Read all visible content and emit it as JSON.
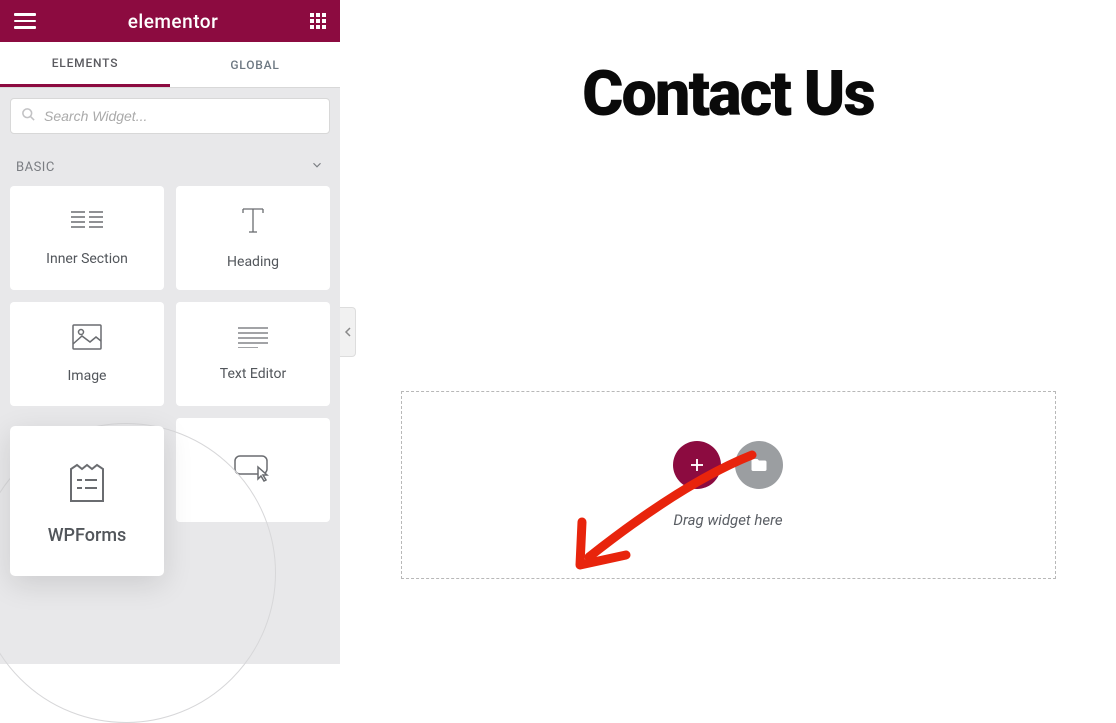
{
  "header": {
    "brand": "elementor"
  },
  "tabs": {
    "elements": "ELEMENTS",
    "global": "GLOBAL"
  },
  "search": {
    "placeholder": "Search Widget..."
  },
  "category": {
    "basic_label": "BASIC"
  },
  "widgets": {
    "inner_section": "Inner Section",
    "heading": "Heading",
    "image": "Image",
    "text_editor": "Text Editor",
    "wpforms": "WPForms"
  },
  "canvas": {
    "page_title": "Contact Us",
    "drop_hint": "Drag widget here"
  }
}
